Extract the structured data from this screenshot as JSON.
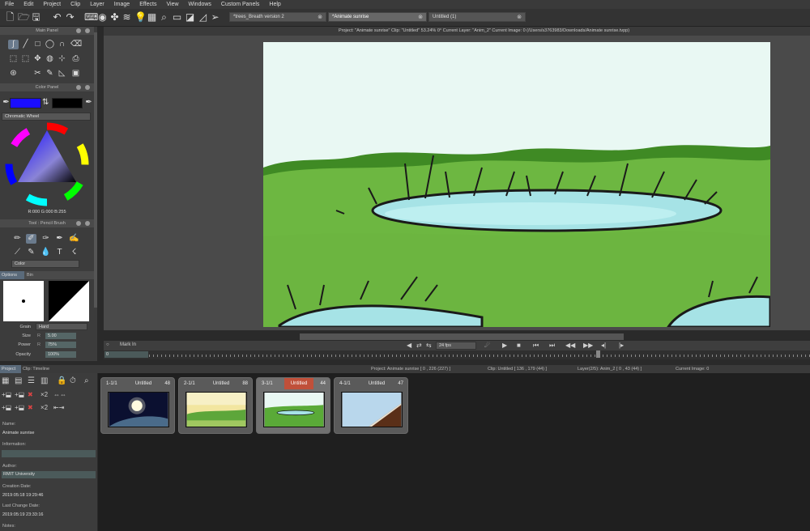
{
  "menu": [
    "File",
    "Edit",
    "Project",
    "Clip",
    "Layer",
    "Image",
    "Effects",
    "View",
    "Windows",
    "Custom Panels",
    "Help"
  ],
  "doc_tabs": [
    {
      "label": "*trees_Breath version 2",
      "active": false
    },
    {
      "label": "*Animate sunrise",
      "active": true
    },
    {
      "label": "Untitled (1)",
      "active": false
    }
  ],
  "info_bar": "Project: \"Animate sunrise\"  Clip: \"Untitled\"  53.24%   0°  Current Layer: \"Anim_2\"  Current Image: 0 (/Users/s3763983/Downloads/Animate sunrise.tvpp)",
  "main_panel": {
    "title": "Main Panel"
  },
  "color_panel": {
    "title": "Color Panel",
    "primary_color": "#1a0dff",
    "secondary_color": "#000000",
    "mode": "Chromatic Wheel",
    "readout": "R:000 G:000 B:255"
  },
  "tool_panel": {
    "title": "Tool : Pencil Brush",
    "color_mode": "Color"
  },
  "options": {
    "tabs": [
      "Options",
      "Bin"
    ],
    "grain_label": "Grain",
    "grain_value": "Hard",
    "size_label": "Size",
    "size_value": "5.00",
    "power_label": "Power",
    "power_value": "75%",
    "opacity_label": "Opacity",
    "opacity_value": "100%",
    "r_prefix": "R"
  },
  "timeline": {
    "mark_in": "Mark In",
    "fps": "24 fps",
    "frame_value": "0"
  },
  "status": {
    "tabs": [
      "Project",
      "Clip: Timeline"
    ],
    "project": "Project: Animate sunrise [ 0 , 226  (227) ]",
    "clip": "Clip: Untitled [ 136 , 179  (44) ]",
    "layer": "Layer(2/5): Anim_2 [ 0 , 43  (44) ]",
    "image": "Current Image: 0"
  },
  "project_meta": {
    "name_label": "Name:",
    "name": "Animate sunrise",
    "info_label": "Information:",
    "author_label": "Author:",
    "author": "RMIT University",
    "created_label": "Creation Date:",
    "created": "2019:05:18 19:29:46",
    "changed_label": "Last Change Date:",
    "changed": "2019:05:19 23:33:16",
    "notes_label": "Notes:"
  },
  "clips": [
    {
      "num": "1-1/1",
      "name": "Untitled",
      "frames": "48",
      "active": false
    },
    {
      "num": "2-1/1",
      "name": "Untitled",
      "frames": "88",
      "active": false
    },
    {
      "num": "3-1/1",
      "name": "Untitled",
      "frames": "44",
      "active": true
    },
    {
      "num": "4-1/1",
      "name": "Untitled",
      "frames": "47",
      "active": false
    }
  ]
}
